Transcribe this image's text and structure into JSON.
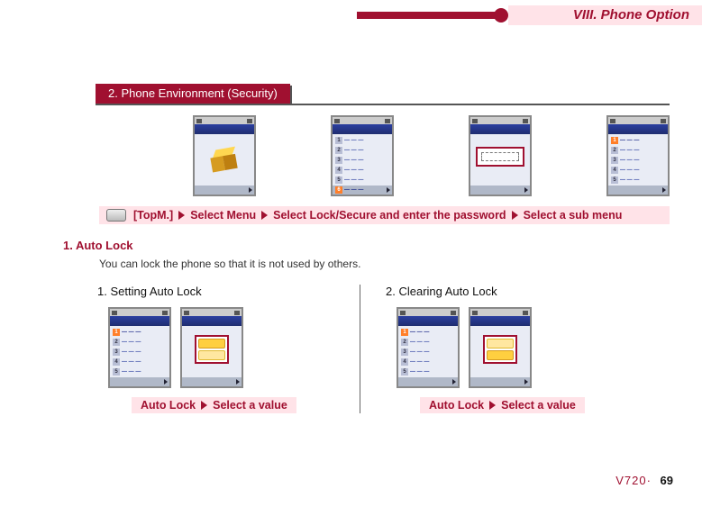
{
  "header": {
    "chapter": "VIII. Phone Option"
  },
  "section": {
    "num_title": "2. Phone Environment (Security)"
  },
  "nav_path": {
    "start": "[TopM.]",
    "steps": [
      "Select Menu",
      "Select Lock/Secure and enter the password",
      "Select a sub menu"
    ]
  },
  "subsection": {
    "num_title": "1. Auto Lock",
    "description": "You can lock the phone so that it is not used by others."
  },
  "columns": {
    "left": {
      "heading": "1. Setting Auto Lock",
      "band": {
        "label": "Auto Lock",
        "after": "Select a value"
      }
    },
    "right": {
      "heading": "2. Clearing Auto Lock",
      "band": {
        "label": "Auto Lock",
        "after": "Select a value"
      }
    }
  },
  "footer": {
    "model": "V720·",
    "page": "69"
  }
}
